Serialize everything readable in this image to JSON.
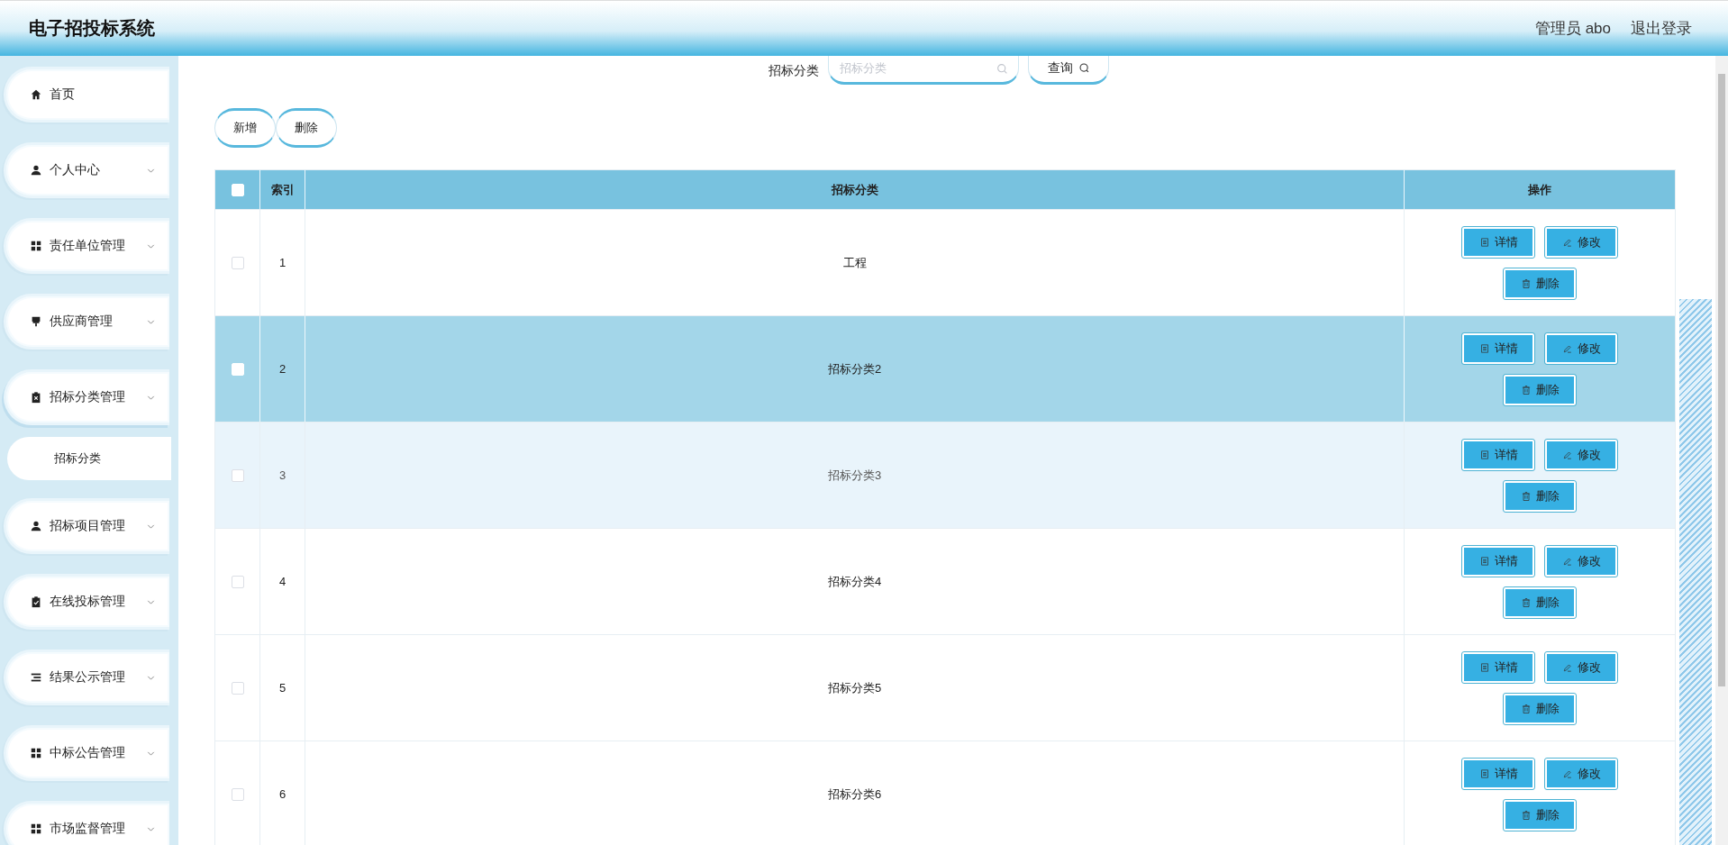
{
  "header": {
    "title": "电子招投标系统",
    "user": "管理员 abo",
    "logout": "退出登录"
  },
  "sidebar": {
    "items": [
      {
        "label": "首页",
        "kind": "link",
        "expanded": false
      },
      {
        "label": "个人中心",
        "kind": "group",
        "expanded": false
      },
      {
        "label": "责任单位管理",
        "kind": "group",
        "expanded": false
      },
      {
        "label": "供应商管理",
        "kind": "group",
        "expanded": false
      },
      {
        "label": "招标分类管理",
        "kind": "group",
        "expanded": true,
        "children": [
          {
            "label": "招标分类"
          }
        ]
      },
      {
        "label": "招标项目管理",
        "kind": "group",
        "expanded": false
      },
      {
        "label": "在线投标管理",
        "kind": "group",
        "expanded": false
      },
      {
        "label": "结果公示管理",
        "kind": "group",
        "expanded": false
      },
      {
        "label": "中标公告管理",
        "kind": "group",
        "expanded": false
      },
      {
        "label": "市场监督管理",
        "kind": "group",
        "expanded": false
      }
    ]
  },
  "search": {
    "label": "招标分类",
    "placeholder": "招标分类",
    "button": "查询"
  },
  "toolbar": {
    "buttons": [
      "新增",
      "删除"
    ]
  },
  "table": {
    "columns": [
      "索引",
      "招标分类",
      "操作"
    ],
    "all_checked": false,
    "rows": [
      {
        "index": "1",
        "name": "工程",
        "selected": false,
        "hovered": false,
        "checked": false,
        "actions": [
          "详情",
          "修改",
          "删除"
        ]
      },
      {
        "index": "2",
        "name": "招标分类2",
        "selected": true,
        "hovered": false,
        "checked": false,
        "actions": [
          "详情",
          "修改",
          "删除"
        ]
      },
      {
        "index": "3",
        "name": "招标分类3",
        "selected": false,
        "hovered": true,
        "checked": false,
        "actions": [
          "详情",
          "修改",
          "删除"
        ]
      },
      {
        "index": "4",
        "name": "招标分类4",
        "selected": false,
        "hovered": false,
        "checked": false,
        "actions": [
          "详情",
          "修改",
          "删除"
        ]
      },
      {
        "index": "5",
        "name": "招标分类5",
        "selected": false,
        "hovered": false,
        "checked": false,
        "actions": [
          "详情",
          "修改",
          "删除"
        ]
      },
      {
        "index": "6",
        "name": "招标分类6",
        "selected": false,
        "hovered": false,
        "checked": false,
        "actions": [
          "详情",
          "修改",
          "删除"
        ]
      }
    ]
  }
}
